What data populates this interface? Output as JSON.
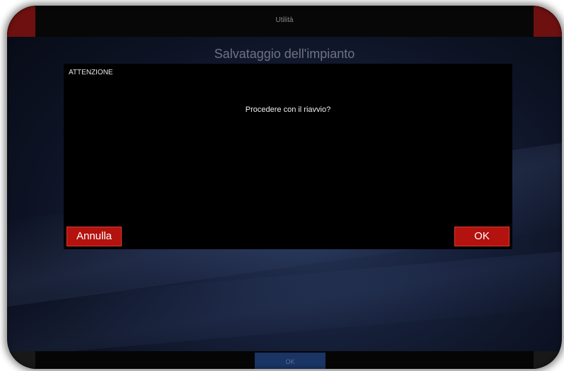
{
  "header": {
    "title": "Utilità"
  },
  "page": {
    "title": "Salvataggio dell'impianto"
  },
  "dialog": {
    "heading": "ATTENZIONE",
    "message": "Procedere con il riavvio?",
    "cancel_label": "Annulla",
    "ok_label": "OK"
  },
  "footer": {
    "ok_label": "OK"
  },
  "colors": {
    "button_red": "#b3120e",
    "footer_blue": "#1a3464",
    "dialog_bg": "#000000"
  }
}
